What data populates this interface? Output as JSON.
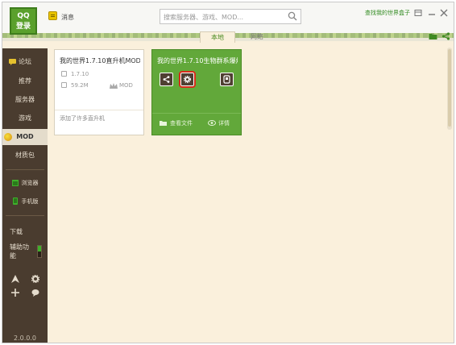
{
  "app": {
    "logo_line1": "QQ",
    "logo_line2": "登录",
    "version": "2.0.0.0",
    "accent": "#5aa02c",
    "sidebar_bg": "#4a3c2f"
  },
  "header": {
    "message_label": "消息",
    "search_placeholder": "搜索服务器、游戏、MOD...",
    "promo_link": "查找我的世界盒子",
    "tabs": [
      {
        "label": "本地",
        "active": true
      },
      {
        "label": "网络",
        "active": false
      }
    ]
  },
  "sidebar": {
    "items": [
      {
        "label": "论坛",
        "icon": "forum-icon"
      },
      {
        "label": "推荐"
      },
      {
        "label": "服务器"
      },
      {
        "label": "游戏"
      },
      {
        "label": "MOD",
        "active": true
      },
      {
        "label": "材质包"
      },
      {
        "label": "浏览器",
        "icon": "browser-icon"
      },
      {
        "label": "手机版",
        "icon": "phone-icon"
      },
      {
        "label": "下载"
      },
      {
        "label": "辅助功能",
        "toggle_on": true
      }
    ],
    "tool_icons": [
      "arrow-icon",
      "gear-icon",
      "move-icon",
      "chat-icon"
    ]
  },
  "main": {
    "cards": [
      {
        "title": "我的世界1.7.10直升机MOD",
        "version": "1.7.10",
        "size": "59.2M",
        "type": "MOD",
        "footer": "添加了许多直升机"
      },
      {
        "title": "我的世界1.7.10生物群系爆炸",
        "actions": [
          "share-icon",
          "settings-icon",
          "launch-icon"
        ],
        "selected_action": "settings-icon",
        "view_files": "查看文件",
        "details": "详情"
      }
    ]
  }
}
